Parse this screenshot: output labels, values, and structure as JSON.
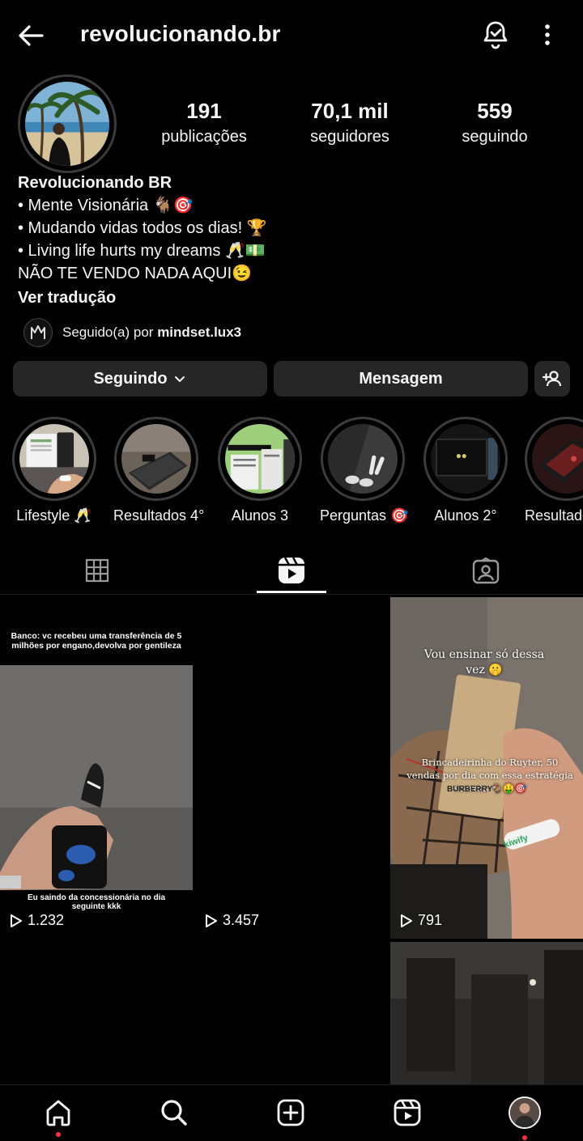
{
  "header": {
    "username": "revolucionando.br"
  },
  "profile": {
    "stats": [
      {
        "value": "191",
        "label": "publicações"
      },
      {
        "value": "70,1 mil",
        "label": "seguidores"
      },
      {
        "value": "559",
        "label": "seguindo"
      }
    ],
    "bio": {
      "name": "Revolucionando BR",
      "lines": [
        "• Mente Visionária 🐐🎯",
        "• Mudando vidas todos os dias! 🏆",
        "• Living life hurts my dreams 🥂💵",
        "NÃO TE VENDO NADA AQUI😉"
      ],
      "translate": "Ver tradução"
    },
    "followed_by": {
      "prefix": "Seguido(a) por ",
      "user": "mindset.lux3"
    }
  },
  "actions": {
    "following": "Seguindo",
    "message": "Mensagem"
  },
  "highlights": [
    {
      "label": "Lifestyle 🥂"
    },
    {
      "label": "Resultados 4°"
    },
    {
      "label": "Alunos 3"
    },
    {
      "label": "Perguntas 🎯"
    },
    {
      "label": "Alunos 2°"
    },
    {
      "label": "Resultado"
    }
  ],
  "tabs": {
    "active": "reels",
    "items": [
      "grid-icon",
      "reels-icon",
      "tagged-icon"
    ]
  },
  "grid": [
    {
      "views": "1.232",
      "caption_top": "Banco: vc recebeu uma transferência de 5 milhões por engano,devolva por gentileza",
      "caption_bottom": "Eu saindo da concessionária no dia seguinte kkk"
    },
    {
      "views": "3.457"
    },
    {
      "views": "791",
      "caption_top": "Vou ensinar só dessa vez 🤫",
      "caption_mid": "Brincadeirinha do Ruyter, 50 vendas por dia com essa estratégia secreta 🐐🤑🎯",
      "bracelet": "kiwify",
      "tag": "BURBERRY"
    },
    {},
    {},
    {}
  ],
  "nav": {
    "items": [
      "home-icon",
      "search-icon",
      "create-icon",
      "reels-icon",
      "profile-avatar"
    ]
  },
  "colors": {
    "background": "#000000",
    "button": "#262626",
    "notification_dot": "#ff3040"
  }
}
